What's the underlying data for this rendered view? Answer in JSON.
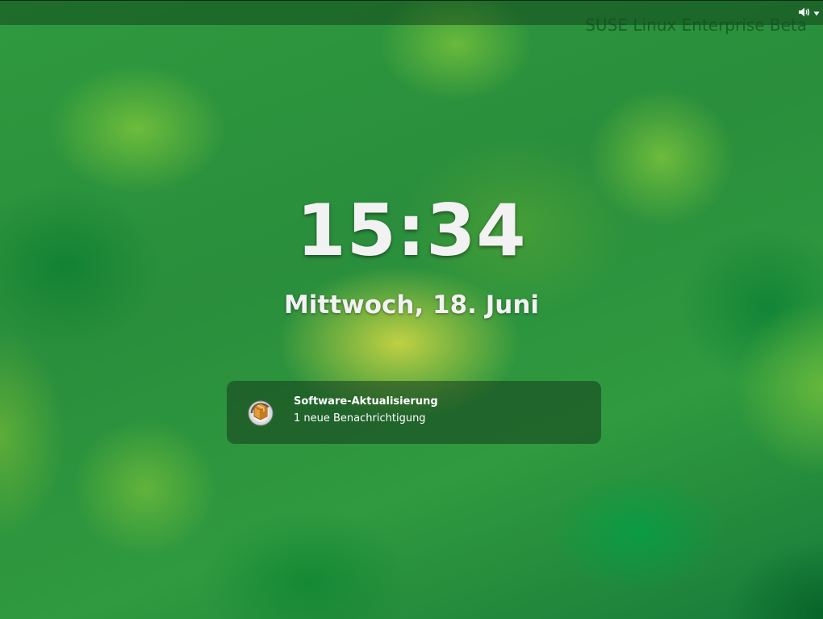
{
  "top_bar": {
    "volume_icon": "speaker-volume-icon",
    "menu_icon": "dropdown-arrow-icon"
  },
  "watermark": "SUSE Linux Enterprise Beta",
  "lock_screen": {
    "time": "15:34",
    "date": "Mittwoch, 18. Juni"
  },
  "notification": {
    "icon": "software-update-icon",
    "title": "Software-Aktualisierung",
    "subtitle": "1 neue Benachrichtigung"
  },
  "colors": {
    "background": "#2a8a3a",
    "text": "#f2f2f2",
    "notification_bg": "#163c1c"
  }
}
